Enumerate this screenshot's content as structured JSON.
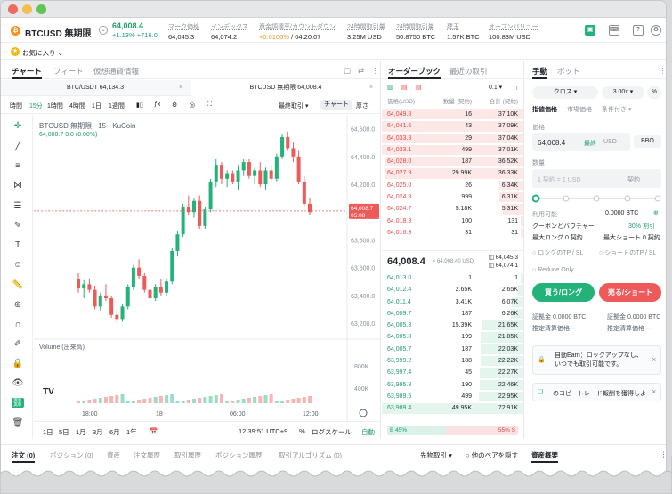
{
  "ticker": {
    "symbol": "BTCUSD 無期限",
    "last_price": "64,008.4",
    "change": "+1.13%  +716.0",
    "stats": [
      {
        "label": "マーク価格",
        "value": "64,045.3"
      },
      {
        "label": "インデックス",
        "value": "64,074.2"
      },
      {
        "label": "資金調達率/カウントダウン",
        "value_highlight": "+0.0100%",
        "value": " / 04:20:07"
      },
      {
        "label": "24時間取引量",
        "value": "3.25M USD"
      },
      {
        "label": "24時間取引量",
        "value": "50.8750 BTC"
      },
      {
        "label": "建玉",
        "value": "1.57K BTC"
      },
      {
        "label": "オープンバリュー",
        "value": "100.83M USD"
      }
    ]
  },
  "favorites": {
    "label": "お気に入り",
    "chevron": "⌄"
  },
  "chart_panel": {
    "tabs": [
      "チャート",
      "フィード",
      "仮想通貨情報"
    ],
    "subtabs": [
      "BTC/USDT 64,134.3",
      "BTCUSD 無期限 64,008.4"
    ],
    "timeframes": [
      "時間",
      "15分",
      "1時間",
      "4時間",
      "1日",
      "1週間"
    ],
    "active_timeframe": "15分",
    "toolbar_right": [
      "最終取引 ▾",
      "チャート",
      "厚さ"
    ],
    "legend_title": "BTCUSD 無期限 · 15 · KuCoin",
    "legend_values": "64,008.7  0.0 (0.00%)",
    "volume_label": "Volume (出来高)",
    "tv_logo": "TV",
    "bottom_controls": [
      "1日",
      "5日",
      "1月",
      "3月",
      "6月",
      "1年"
    ],
    "clock": "12:39:51 UTC+9",
    "log_controls": [
      "%",
      "ログスケール",
      "自動"
    ],
    "price_tag": [
      "64,008.7",
      "05:08"
    ]
  },
  "chart_data": {
    "type": "candlestick",
    "y_ticks": [
      "64,600.0",
      "64,400.0",
      "64,200.0",
      "64,000.0",
      "63,800.0",
      "63,600.0",
      "63,400.0",
      "63,200.0"
    ],
    "y_tick_values": [
      64600,
      64400,
      64200,
      64000,
      63800,
      63600,
      63400,
      63200
    ],
    "ylim": [
      63130,
      64700
    ],
    "x_ticks": [
      "18:00",
      "18",
      "06:00",
      "12:00"
    ],
    "volume_ticks": [
      "800K",
      "400K"
    ],
    "last_price_line": 64008.7,
    "candles": [
      [
        63520,
        63560,
        63420,
        63450
      ],
      [
        63450,
        63510,
        63380,
        63480
      ],
      [
        63480,
        63520,
        63420,
        63440
      ],
      [
        63440,
        63470,
        63300,
        63320
      ],
      [
        63320,
        63420,
        63290,
        63400
      ],
      [
        63400,
        63480,
        63360,
        63380
      ],
      [
        63380,
        63400,
        63240,
        63260
      ],
      [
        63260,
        63300,
        63200,
        63230
      ],
      [
        63230,
        63340,
        63210,
        63320
      ],
      [
        63320,
        63480,
        63300,
        63460
      ],
      [
        63460,
        63620,
        63440,
        63600
      ],
      [
        63600,
        63660,
        63520,
        63540
      ],
      [
        63540,
        63560,
        63420,
        63440
      ],
      [
        63440,
        63460,
        63360,
        63380
      ],
      [
        63380,
        63480,
        63360,
        63460
      ],
      [
        63460,
        63520,
        63400,
        63420
      ],
      [
        63420,
        63520,
        63400,
        63500
      ],
      [
        63500,
        63740,
        63480,
        63720
      ],
      [
        63720,
        63860,
        63680,
        63840
      ],
      [
        63840,
        64060,
        63820,
        64040
      ],
      [
        64040,
        64120,
        63980,
        64000
      ],
      [
        64000,
        64100,
        63960,
        64080
      ],
      [
        64080,
        64120,
        63880,
        63900
      ],
      [
        63900,
        64040,
        63880,
        64020
      ],
      [
        64020,
        64240,
        64000,
        64220
      ],
      [
        64220,
        64380,
        64180,
        64340
      ],
      [
        64340,
        64360,
        64200,
        64240
      ],
      [
        64240,
        64300,
        64180,
        64280
      ],
      [
        64280,
        64300,
        64200,
        64220
      ],
      [
        64220,
        64340,
        64160,
        64300
      ],
      [
        64300,
        64380,
        64260,
        64360
      ],
      [
        64360,
        64380,
        64240,
        64260
      ],
      [
        64260,
        64320,
        64200,
        64300
      ],
      [
        64300,
        64360,
        64180,
        64200
      ],
      [
        64200,
        64320,
        64160,
        64300
      ],
      [
        64300,
        64340,
        64220,
        64240
      ],
      [
        64240,
        64420,
        64220,
        64400
      ],
      [
        64400,
        64560,
        64380,
        64540
      ],
      [
        64540,
        64580,
        64440,
        64460
      ],
      [
        64460,
        64500,
        64360,
        64400
      ],
      [
        64400,
        64440,
        64200,
        64220
      ],
      [
        64220,
        64260,
        64040,
        64060
      ],
      [
        64060,
        64100,
        63980,
        64000
      ]
    ]
  },
  "orderbook": {
    "tabs": [
      "オーダーブック",
      "最近の取引"
    ],
    "precision": "0.1 ▾",
    "headers": [
      "価格(USD)",
      "数量 (契約)",
      "合計 (契約)"
    ],
    "asks": [
      [
        "64,049.8",
        "16",
        "37.10K"
      ],
      [
        "64,041.6",
        "43",
        "37.09K"
      ],
      [
        "64,033.3",
        "29",
        "37.04K"
      ],
      [
        "64,033.1",
        "499",
        "37.01K"
      ],
      [
        "64,028.0",
        "187",
        "36.52K"
      ],
      [
        "64,027.9",
        "29.99K",
        "36.33K"
      ],
      [
        "64,025.0",
        "26",
        "6.34K"
      ],
      [
        "64,024.9",
        "999",
        "6.31K"
      ],
      [
        "64,024.7",
        "5.18K",
        "5.31K"
      ],
      [
        "64,018.3",
        "100",
        "131"
      ],
      [
        "64,016.9",
        "31",
        "31"
      ]
    ],
    "mid_price": "64,008.4",
    "mid_sub": "≈ 64,008.40 USD",
    "mid_mark": "64,045.3",
    "mid_index": "64,074.1",
    "bids": [
      [
        "64,013.0",
        "1",
        "1"
      ],
      [
        "64,012.4",
        "2.65K",
        "2.65K"
      ],
      [
        "64,011.4",
        "3.41K",
        "6.07K"
      ],
      [
        "64,009.7",
        "187",
        "6.26K"
      ],
      [
        "64,005.8",
        "15.39K",
        "21.65K"
      ],
      [
        "64,005.8",
        "199",
        "21.85K"
      ],
      [
        "64,005.7",
        "187",
        "22.03K"
      ],
      [
        "63,999.2",
        "188",
        "22.22K"
      ],
      [
        "63,997.4",
        "45",
        "22.27K"
      ],
      [
        "63,995.8",
        "190",
        "22.46K"
      ],
      [
        "63,989.5",
        "499",
        "22.95K"
      ],
      [
        "63,989.4",
        "49.95K",
        "72.91K"
      ]
    ],
    "buy_ratio": "B 45%",
    "sell_ratio": "55% S"
  },
  "order_form": {
    "tabs": [
      "手動",
      "ボット"
    ],
    "margin_mode": "クロス ▾",
    "leverage": "3.00x ▾",
    "order_types": [
      "指値価格",
      "市場価格",
      "条件付き ▾"
    ],
    "price_label": "価格",
    "price_value": "64,008.4",
    "price_last": "最終",
    "price_unit": "USD",
    "bbo": "BBO",
    "qty_label": "数量",
    "qty_placeholder": "1 契約 = 1 USD",
    "qty_unit": "契約",
    "available_label": "利用可能",
    "available_value": "0.0000 BTC",
    "coupon_label": "クーポンとバウチャー",
    "coupon_value": "30% 割引",
    "max_long": "最大ロング 0 契約",
    "max_short": "最大ショート 0 契約",
    "tpsl_long": "ロングのTP / SL",
    "tpsl_short": "ショートのTP / SL",
    "reduce_only": "Reduce Only",
    "buy_button": "買う/ロング",
    "sell_button": "売る/ショート",
    "margin_long": "証拠金 0.0000 BTC",
    "margin_short": "証拠金 0.0000 BTC",
    "liq_long": "推定清算価格 --",
    "liq_short": "推定清算価格 --",
    "promo1": "自動Earn：ロックアップなし、いつでも取引可能です。",
    "promo2": "のコピートレード報酬を獲得しよう"
  },
  "bottom_tabs": [
    "注文 (0)",
    "ポジション (0)",
    "資産",
    "注文履歴",
    "取引履歴",
    "ポジション履歴",
    "取引アルゴリズム (0)"
  ],
  "bottom_right": [
    "先物取引 ▾",
    "他のペアを隠す"
  ],
  "asset_overview": "資産概要"
}
